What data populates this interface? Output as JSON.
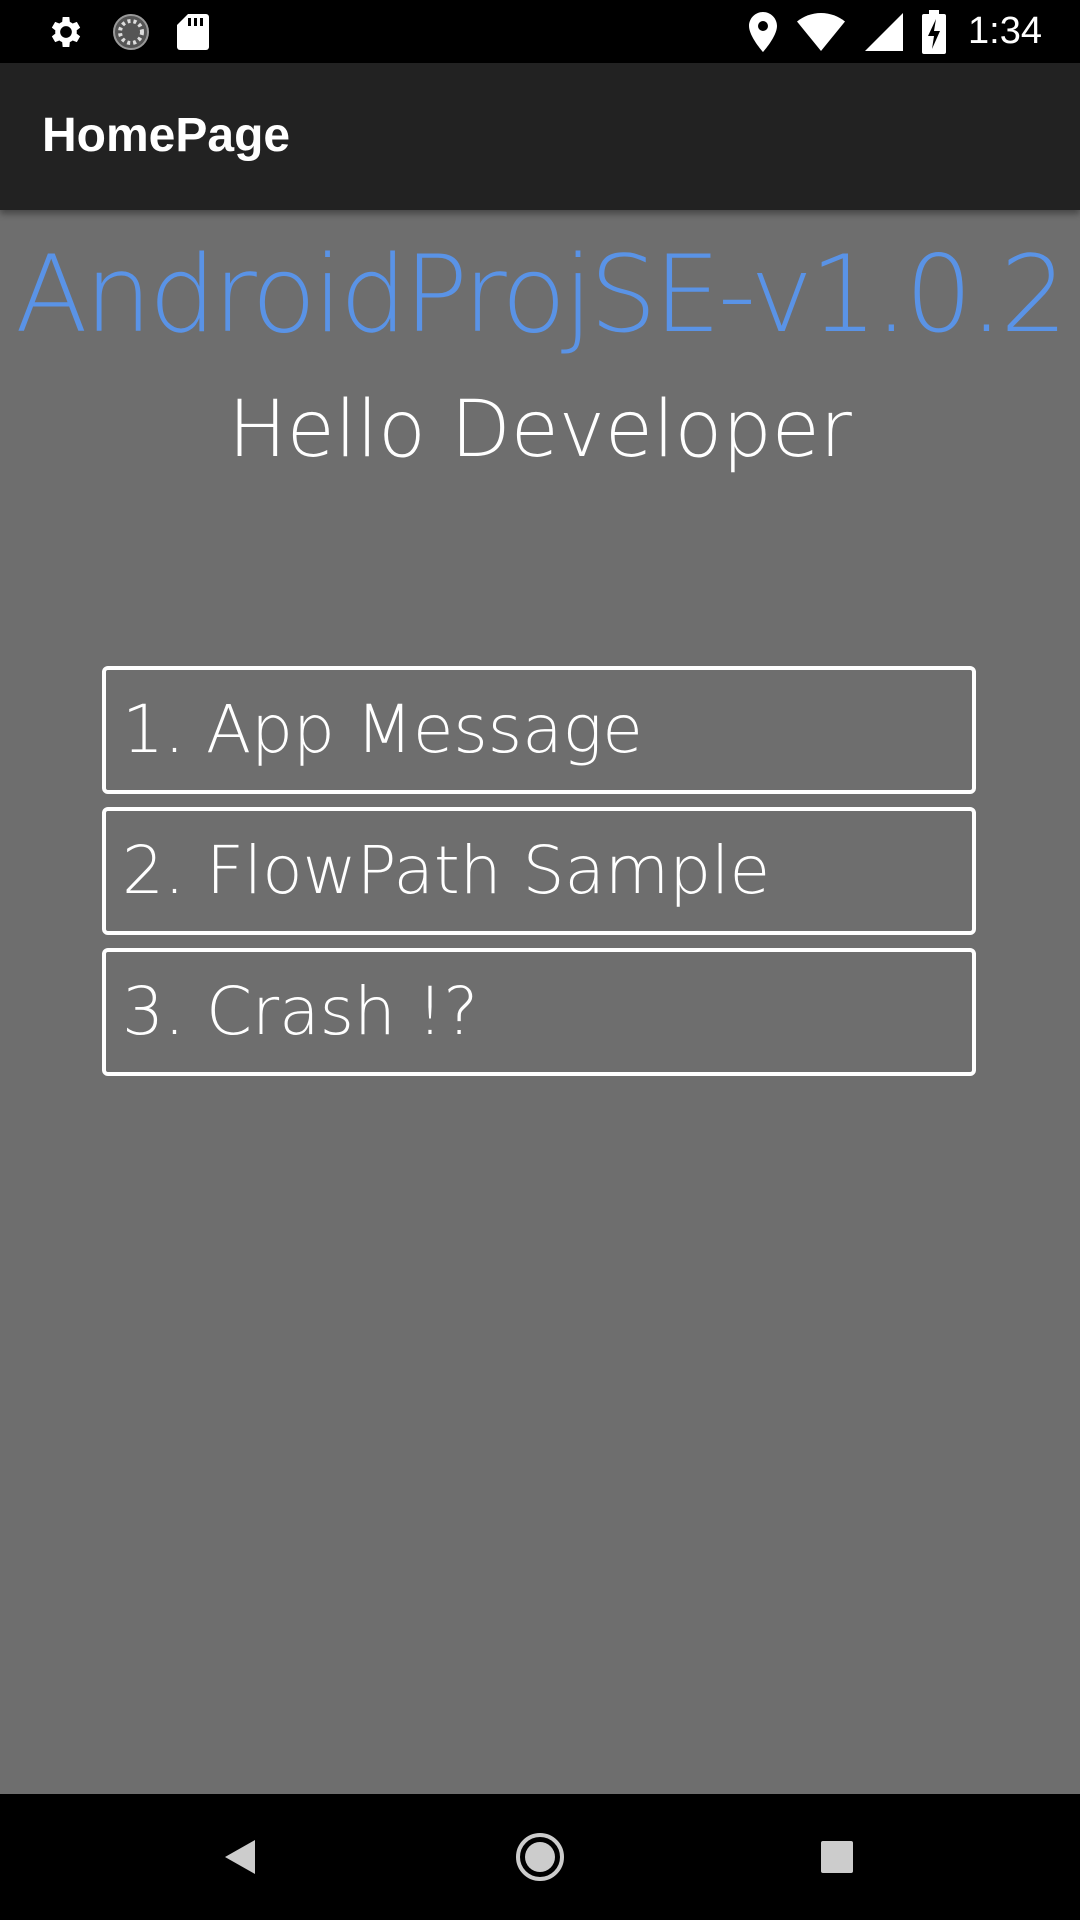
{
  "status_bar": {
    "left_icons": [
      "settings-icon",
      "sync-icon",
      "sd-card-icon"
    ],
    "right_icons": [
      "location-icon",
      "wifi-icon",
      "signal-icon",
      "battery-charging-icon"
    ],
    "time": "1:34"
  },
  "app_bar": {
    "title": "HomePage"
  },
  "main": {
    "project_title": "AndroidProjSE-v1.0.2",
    "greeting": "Hello Developer",
    "menu": [
      {
        "label": "1. App Message"
      },
      {
        "label": "2. FlowPath Sample"
      },
      {
        "label": "3. Crash !?"
      }
    ]
  },
  "nav_bar": {
    "buttons": [
      "back-icon",
      "home-icon",
      "recents-icon"
    ]
  },
  "colors": {
    "background": "#6e6e6e",
    "app_bar": "#222222",
    "accent_title": "#5a93e6",
    "text": "#ffffff"
  }
}
